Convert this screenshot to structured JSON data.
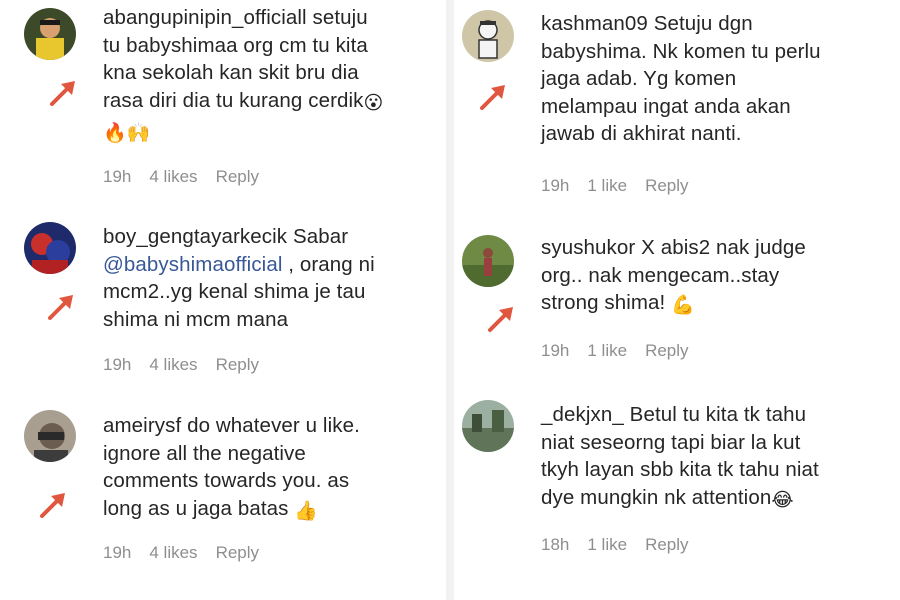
{
  "left": {
    "comments": [
      {
        "username": "abangupinipin_officiall",
        "lines": [
          "setuju",
          "tu babyshimaa org cm tu kita",
          "kna sekolah kan skit bru dia",
          "rasa diri dia tu kurang cerdik"
        ],
        "emoji_inline": "😮",
        "emoji_line": "🔥🙌",
        "time": "19h",
        "likes": "4 likes",
        "reply": "Reply"
      },
      {
        "username": "boy_gengtayarkecik",
        "first_text": "Sabar",
        "mention": "@babyshimaofficial",
        "mention_tail": " , orang ni",
        "lines": [
          "mcm2..yg kenal shima je tau",
          "shima ni mcm mana"
        ],
        "time": "19h",
        "likes": "4 likes",
        "reply": "Reply"
      },
      {
        "username": "ameirysf",
        "first_text": "do whatever u like.",
        "lines": [
          "ignore all the negative",
          "comments towards you. as",
          "long as u jaga batas"
        ],
        "emoji_inline": "👍",
        "time": "19h",
        "likes": "4 likes",
        "reply": "Reply"
      }
    ]
  },
  "right": {
    "comments": [
      {
        "username": "kashman09",
        "first_text": "Setuju dgn",
        "lines": [
          "babyshima. Nk komen tu perlu",
          "jaga adab. Yg komen",
          "melampau ingat anda akan",
          "jawab di akhirat nanti."
        ],
        "time": "19h",
        "likes": "1 like",
        "reply": "Reply"
      },
      {
        "username": "syushukor",
        "first_text": "X abis2 nak judge",
        "lines": [
          "org.. nak mengecam..stay",
          "strong shima!"
        ],
        "emoji_inline": "💪",
        "time": "19h",
        "likes": "1 like",
        "reply": "Reply"
      },
      {
        "username": "_dekjxn_",
        "first_text": "Betul tu kita tk tahu",
        "lines": [
          "niat seseorng tapi biar la kut",
          "tkyh layan sbb kita tk tahu niat",
          "dye mungkin nk attention"
        ],
        "emoji_inline": "😂",
        "time": "18h",
        "likes": "1 like",
        "reply": "Reply"
      }
    ]
  },
  "colors": {
    "text": "#262626",
    "meta": "#8e8e8e",
    "mention": "#385898",
    "arrow": "#e0563f",
    "divider": "#f2f2f2"
  },
  "icons": [
    "avatar",
    "red-arrow-pointer-icon"
  ]
}
